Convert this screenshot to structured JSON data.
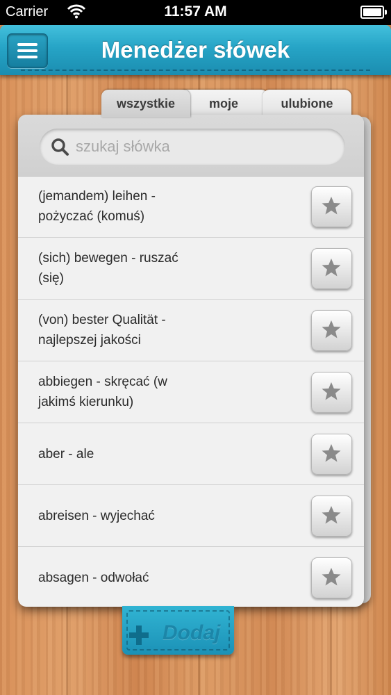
{
  "status_bar": {
    "carrier": "Carrier",
    "time": "11:57 AM"
  },
  "nav": {
    "title": "Menedżer słówek",
    "menu_icon": "hamburger-menu-icon"
  },
  "tabs": [
    {
      "label": "wszystkie",
      "active": true
    },
    {
      "label": "moje",
      "active": false
    },
    {
      "label": "ulubione",
      "active": false
    }
  ],
  "search": {
    "placeholder": "szukaj słówka",
    "value": ""
  },
  "words": [
    {
      "line1": "(jemandem) leihen -",
      "line2": "pożyczać (komuś)"
    },
    {
      "line1": "(sich) bewegen - ruszać",
      "line2": "(się)"
    },
    {
      "line1": "(von) bester Qualität -",
      "line2": "najlepszej jakości"
    },
    {
      "line1": "abbiegen - skręcać (w",
      "line2": "jakimś kierunku)"
    },
    {
      "line1": "aber - ale",
      "line2": ""
    },
    {
      "line1": "abreisen - wyjechać",
      "line2": ""
    },
    {
      "line1": "absagen - odwołać",
      "line2": ""
    }
  ],
  "add_button": {
    "label": "Dodaj",
    "icon": "plus-icon"
  },
  "colors": {
    "accent": "#26a4c6",
    "star": "#8a8a8a"
  }
}
